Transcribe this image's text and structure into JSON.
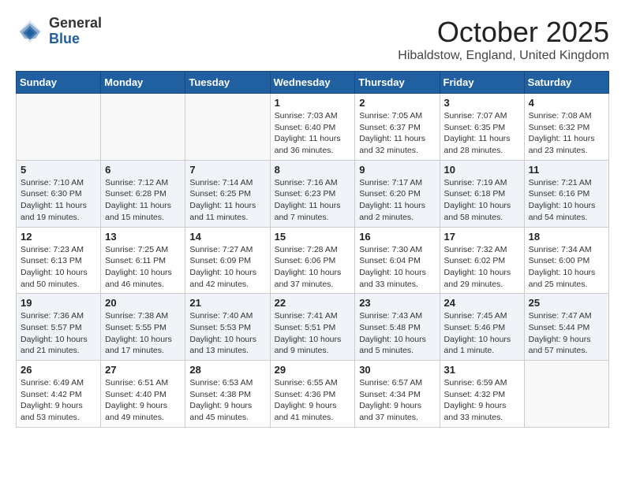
{
  "header": {
    "logo_general": "General",
    "logo_blue": "Blue",
    "month_title": "October 2025",
    "location": "Hibaldstow, England, United Kingdom"
  },
  "weekdays": [
    "Sunday",
    "Monday",
    "Tuesday",
    "Wednesday",
    "Thursday",
    "Friday",
    "Saturday"
  ],
  "weeks": [
    [
      {
        "day": "",
        "info": ""
      },
      {
        "day": "",
        "info": ""
      },
      {
        "day": "",
        "info": ""
      },
      {
        "day": "1",
        "info": "Sunrise: 7:03 AM\nSunset: 6:40 PM\nDaylight: 11 hours\nand 36 minutes."
      },
      {
        "day": "2",
        "info": "Sunrise: 7:05 AM\nSunset: 6:37 PM\nDaylight: 11 hours\nand 32 minutes."
      },
      {
        "day": "3",
        "info": "Sunrise: 7:07 AM\nSunset: 6:35 PM\nDaylight: 11 hours\nand 28 minutes."
      },
      {
        "day": "4",
        "info": "Sunrise: 7:08 AM\nSunset: 6:32 PM\nDaylight: 11 hours\nand 23 minutes."
      }
    ],
    [
      {
        "day": "5",
        "info": "Sunrise: 7:10 AM\nSunset: 6:30 PM\nDaylight: 11 hours\nand 19 minutes."
      },
      {
        "day": "6",
        "info": "Sunrise: 7:12 AM\nSunset: 6:28 PM\nDaylight: 11 hours\nand 15 minutes."
      },
      {
        "day": "7",
        "info": "Sunrise: 7:14 AM\nSunset: 6:25 PM\nDaylight: 11 hours\nand 11 minutes."
      },
      {
        "day": "8",
        "info": "Sunrise: 7:16 AM\nSunset: 6:23 PM\nDaylight: 11 hours\nand 7 minutes."
      },
      {
        "day": "9",
        "info": "Sunrise: 7:17 AM\nSunset: 6:20 PM\nDaylight: 11 hours\nand 2 minutes."
      },
      {
        "day": "10",
        "info": "Sunrise: 7:19 AM\nSunset: 6:18 PM\nDaylight: 10 hours\nand 58 minutes."
      },
      {
        "day": "11",
        "info": "Sunrise: 7:21 AM\nSunset: 6:16 PM\nDaylight: 10 hours\nand 54 minutes."
      }
    ],
    [
      {
        "day": "12",
        "info": "Sunrise: 7:23 AM\nSunset: 6:13 PM\nDaylight: 10 hours\nand 50 minutes."
      },
      {
        "day": "13",
        "info": "Sunrise: 7:25 AM\nSunset: 6:11 PM\nDaylight: 10 hours\nand 46 minutes."
      },
      {
        "day": "14",
        "info": "Sunrise: 7:27 AM\nSunset: 6:09 PM\nDaylight: 10 hours\nand 42 minutes."
      },
      {
        "day": "15",
        "info": "Sunrise: 7:28 AM\nSunset: 6:06 PM\nDaylight: 10 hours\nand 37 minutes."
      },
      {
        "day": "16",
        "info": "Sunrise: 7:30 AM\nSunset: 6:04 PM\nDaylight: 10 hours\nand 33 minutes."
      },
      {
        "day": "17",
        "info": "Sunrise: 7:32 AM\nSunset: 6:02 PM\nDaylight: 10 hours\nand 29 minutes."
      },
      {
        "day": "18",
        "info": "Sunrise: 7:34 AM\nSunset: 6:00 PM\nDaylight: 10 hours\nand 25 minutes."
      }
    ],
    [
      {
        "day": "19",
        "info": "Sunrise: 7:36 AM\nSunset: 5:57 PM\nDaylight: 10 hours\nand 21 minutes."
      },
      {
        "day": "20",
        "info": "Sunrise: 7:38 AM\nSunset: 5:55 PM\nDaylight: 10 hours\nand 17 minutes."
      },
      {
        "day": "21",
        "info": "Sunrise: 7:40 AM\nSunset: 5:53 PM\nDaylight: 10 hours\nand 13 minutes."
      },
      {
        "day": "22",
        "info": "Sunrise: 7:41 AM\nSunset: 5:51 PM\nDaylight: 10 hours\nand 9 minutes."
      },
      {
        "day": "23",
        "info": "Sunrise: 7:43 AM\nSunset: 5:48 PM\nDaylight: 10 hours\nand 5 minutes."
      },
      {
        "day": "24",
        "info": "Sunrise: 7:45 AM\nSunset: 5:46 PM\nDaylight: 10 hours\nand 1 minute."
      },
      {
        "day": "25",
        "info": "Sunrise: 7:47 AM\nSunset: 5:44 PM\nDaylight: 9 hours\nand 57 minutes."
      }
    ],
    [
      {
        "day": "26",
        "info": "Sunrise: 6:49 AM\nSunset: 4:42 PM\nDaylight: 9 hours\nand 53 minutes."
      },
      {
        "day": "27",
        "info": "Sunrise: 6:51 AM\nSunset: 4:40 PM\nDaylight: 9 hours\nand 49 minutes."
      },
      {
        "day": "28",
        "info": "Sunrise: 6:53 AM\nSunset: 4:38 PM\nDaylight: 9 hours\nand 45 minutes."
      },
      {
        "day": "29",
        "info": "Sunrise: 6:55 AM\nSunset: 4:36 PM\nDaylight: 9 hours\nand 41 minutes."
      },
      {
        "day": "30",
        "info": "Sunrise: 6:57 AM\nSunset: 4:34 PM\nDaylight: 9 hours\nand 37 minutes."
      },
      {
        "day": "31",
        "info": "Sunrise: 6:59 AM\nSunset: 4:32 PM\nDaylight: 9 hours\nand 33 minutes."
      },
      {
        "day": "",
        "info": ""
      }
    ]
  ]
}
